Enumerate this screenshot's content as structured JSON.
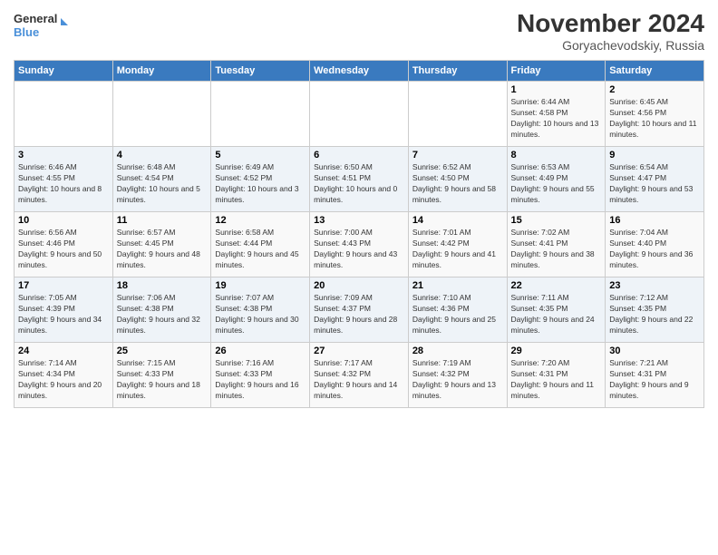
{
  "logo": {
    "line1": "General",
    "line2": "Blue"
  },
  "title": "November 2024",
  "subtitle": "Goryachevodskiy, Russia",
  "days_header": [
    "Sunday",
    "Monday",
    "Tuesday",
    "Wednesday",
    "Thursday",
    "Friday",
    "Saturday"
  ],
  "weeks": [
    [
      {
        "day": "",
        "info": ""
      },
      {
        "day": "",
        "info": ""
      },
      {
        "day": "",
        "info": ""
      },
      {
        "day": "",
        "info": ""
      },
      {
        "day": "",
        "info": ""
      },
      {
        "day": "1",
        "info": "Sunrise: 6:44 AM\nSunset: 4:58 PM\nDaylight: 10 hours and 13 minutes."
      },
      {
        "day": "2",
        "info": "Sunrise: 6:45 AM\nSunset: 4:56 PM\nDaylight: 10 hours and 11 minutes."
      }
    ],
    [
      {
        "day": "3",
        "info": "Sunrise: 6:46 AM\nSunset: 4:55 PM\nDaylight: 10 hours and 8 minutes."
      },
      {
        "day": "4",
        "info": "Sunrise: 6:48 AM\nSunset: 4:54 PM\nDaylight: 10 hours and 5 minutes."
      },
      {
        "day": "5",
        "info": "Sunrise: 6:49 AM\nSunset: 4:52 PM\nDaylight: 10 hours and 3 minutes."
      },
      {
        "day": "6",
        "info": "Sunrise: 6:50 AM\nSunset: 4:51 PM\nDaylight: 10 hours and 0 minutes."
      },
      {
        "day": "7",
        "info": "Sunrise: 6:52 AM\nSunset: 4:50 PM\nDaylight: 9 hours and 58 minutes."
      },
      {
        "day": "8",
        "info": "Sunrise: 6:53 AM\nSunset: 4:49 PM\nDaylight: 9 hours and 55 minutes."
      },
      {
        "day": "9",
        "info": "Sunrise: 6:54 AM\nSunset: 4:47 PM\nDaylight: 9 hours and 53 minutes."
      }
    ],
    [
      {
        "day": "10",
        "info": "Sunrise: 6:56 AM\nSunset: 4:46 PM\nDaylight: 9 hours and 50 minutes."
      },
      {
        "day": "11",
        "info": "Sunrise: 6:57 AM\nSunset: 4:45 PM\nDaylight: 9 hours and 48 minutes."
      },
      {
        "day": "12",
        "info": "Sunrise: 6:58 AM\nSunset: 4:44 PM\nDaylight: 9 hours and 45 minutes."
      },
      {
        "day": "13",
        "info": "Sunrise: 7:00 AM\nSunset: 4:43 PM\nDaylight: 9 hours and 43 minutes."
      },
      {
        "day": "14",
        "info": "Sunrise: 7:01 AM\nSunset: 4:42 PM\nDaylight: 9 hours and 41 minutes."
      },
      {
        "day": "15",
        "info": "Sunrise: 7:02 AM\nSunset: 4:41 PM\nDaylight: 9 hours and 38 minutes."
      },
      {
        "day": "16",
        "info": "Sunrise: 7:04 AM\nSunset: 4:40 PM\nDaylight: 9 hours and 36 minutes."
      }
    ],
    [
      {
        "day": "17",
        "info": "Sunrise: 7:05 AM\nSunset: 4:39 PM\nDaylight: 9 hours and 34 minutes."
      },
      {
        "day": "18",
        "info": "Sunrise: 7:06 AM\nSunset: 4:38 PM\nDaylight: 9 hours and 32 minutes."
      },
      {
        "day": "19",
        "info": "Sunrise: 7:07 AM\nSunset: 4:38 PM\nDaylight: 9 hours and 30 minutes."
      },
      {
        "day": "20",
        "info": "Sunrise: 7:09 AM\nSunset: 4:37 PM\nDaylight: 9 hours and 28 minutes."
      },
      {
        "day": "21",
        "info": "Sunrise: 7:10 AM\nSunset: 4:36 PM\nDaylight: 9 hours and 25 minutes."
      },
      {
        "day": "22",
        "info": "Sunrise: 7:11 AM\nSunset: 4:35 PM\nDaylight: 9 hours and 24 minutes."
      },
      {
        "day": "23",
        "info": "Sunrise: 7:12 AM\nSunset: 4:35 PM\nDaylight: 9 hours and 22 minutes."
      }
    ],
    [
      {
        "day": "24",
        "info": "Sunrise: 7:14 AM\nSunset: 4:34 PM\nDaylight: 9 hours and 20 minutes."
      },
      {
        "day": "25",
        "info": "Sunrise: 7:15 AM\nSunset: 4:33 PM\nDaylight: 9 hours and 18 minutes."
      },
      {
        "day": "26",
        "info": "Sunrise: 7:16 AM\nSunset: 4:33 PM\nDaylight: 9 hours and 16 minutes."
      },
      {
        "day": "27",
        "info": "Sunrise: 7:17 AM\nSunset: 4:32 PM\nDaylight: 9 hours and 14 minutes."
      },
      {
        "day": "28",
        "info": "Sunrise: 7:19 AM\nSunset: 4:32 PM\nDaylight: 9 hours and 13 minutes."
      },
      {
        "day": "29",
        "info": "Sunrise: 7:20 AM\nSunset: 4:31 PM\nDaylight: 9 hours and 11 minutes."
      },
      {
        "day": "30",
        "info": "Sunrise: 7:21 AM\nSunset: 4:31 PM\nDaylight: 9 hours and 9 minutes."
      }
    ]
  ]
}
